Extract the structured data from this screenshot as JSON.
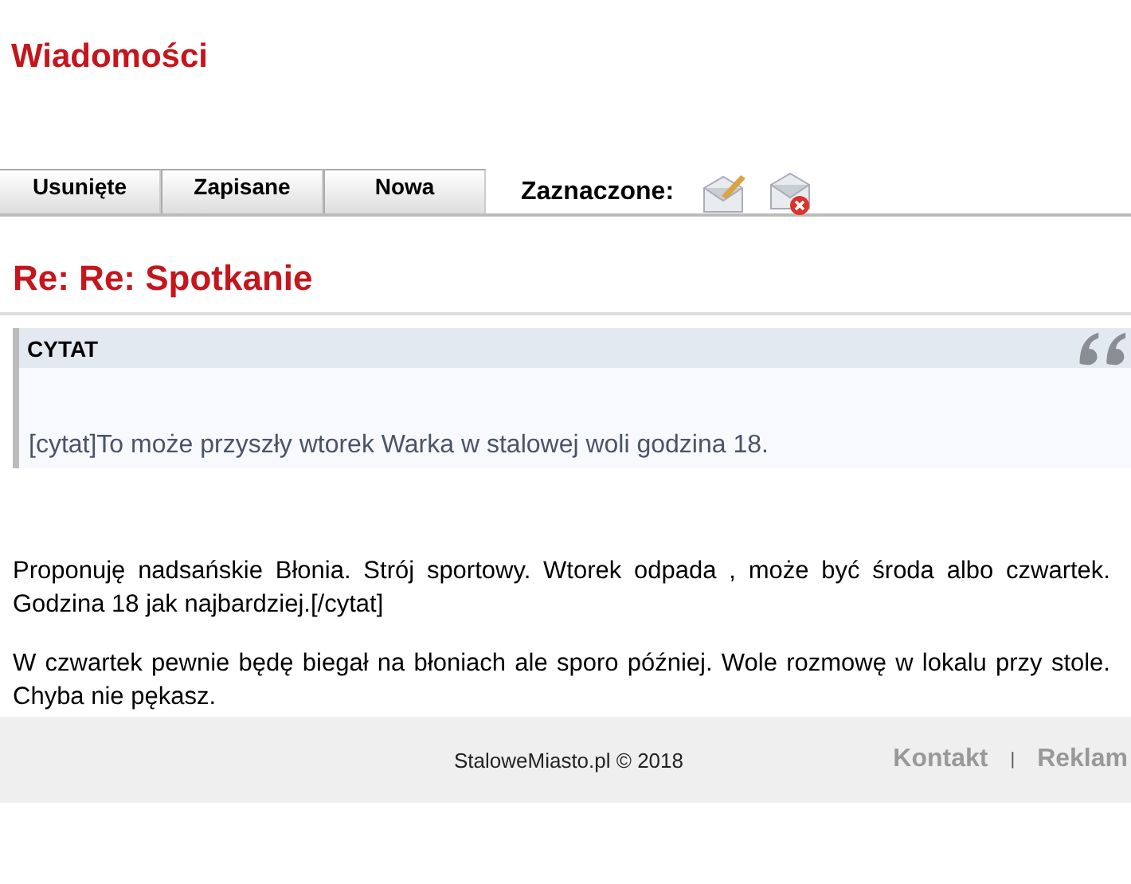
{
  "page_title": "Wiadomości",
  "tabs": [
    {
      "label": "Usunięte"
    },
    {
      "label": "Zapisane"
    },
    {
      "label": "Nowa"
    }
  ],
  "selected_label": "Zaznaczone:",
  "message": {
    "subject": "Re: Re: Spotkanie",
    "quote": {
      "heading": "CYTAT",
      "text": "[cytat]To może przyszły wtorek Warka w stalowej woli godzina 18."
    },
    "paragraphs": [
      "Proponuję nadsańskie Błonia. Strój sportowy. Wtorek odpada , może być środa albo czwartek. Godzina 18 jak najbardziej.[/cytat]",
      "W czwartek pewnie będę biegał na błoniach ale sporo później. Wole rozmowę w lokalu przy stole. Chyba nie pękasz."
    ]
  },
  "footer": {
    "copyright": "StaloweMiasto.pl © 2018",
    "links": [
      "Kontakt",
      "Reklam"
    ],
    "separator": "|"
  }
}
